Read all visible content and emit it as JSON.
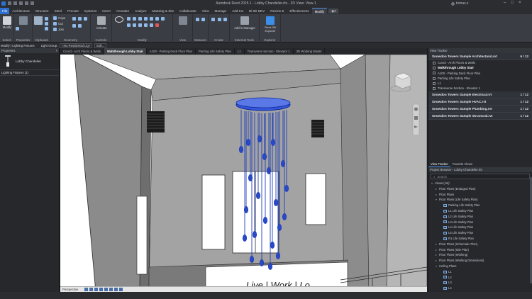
{
  "app": {
    "title": "Autodesk Revit 2025.1 - Lobby Chandelier.rfa - 3D View: View 1",
    "user": "tomas.z"
  },
  "ribbon_tabs": [
    "File",
    "Architecture",
    "Structure",
    "Steel",
    "Precast",
    "Systems",
    "Insert",
    "Annotate",
    "Analyze",
    "Massing & Site",
    "Collaborate",
    "View",
    "Manage",
    "Add-Ins",
    "Bi-IDI DEV",
    "Revizto 5",
    "Effectiveness",
    "Modify"
  ],
  "ribbon_groups": [
    {
      "label": "Select",
      "top": "Modify"
    },
    {
      "label": "Properties",
      "top": ""
    },
    {
      "label": "Clipboard",
      "top": ""
    },
    {
      "label": "Geometry",
      "top": ""
    },
    {
      "label": "Controls",
      "top": "Activate"
    },
    {
      "label": "Modify",
      "top": ""
    },
    {
      "label": "View",
      "top": ""
    },
    {
      "label": "Measure",
      "top": ""
    },
    {
      "label": "Create",
      "top": ""
    },
    {
      "label": "External Tools",
      "top": "Add-in Manager"
    },
    {
      "label": "Explorer",
      "top": "Revit DB Explorer"
    }
  ],
  "ribbon_small": {
    "cope": "Cope",
    "cut": "Cut",
    "join": "Join"
  },
  "context_bar": {
    "mode": "Modify | Lighting Fixtures",
    "light_group": "Light Group:",
    "light_value": "<No Residential Lig>",
    "edit": "Edit..."
  },
  "properties": {
    "title": "Properties",
    "family_name": "Lobby Chandelier",
    "filter": "Lighting Fixtures (1)"
  },
  "view_tabs": [
    {
      "label": "Coord - Arch Floors & Walls",
      "active": false
    },
    {
      "label": "Walkthrough Lobby Stair",
      "active": true
    },
    {
      "label": "A100 - Parking Deck Floor Plan",
      "active": false
    },
    {
      "label": "Parking Life Safety Plan",
      "active": false
    },
    {
      "label": "L1",
      "active": false
    },
    {
      "label": "Transverse Section - Elevator 1",
      "active": false
    },
    {
      "label": "3D Working Model",
      "active": false
    }
  ],
  "viewport": {
    "sign_text": "Live | Work | Lo",
    "view_mode": "Perspective"
  },
  "view_tracker": {
    "title": "View Tracker",
    "models": [
      {
        "name": "Snowdon Towers Sample Architectural.rvt",
        "count": "6 / 12",
        "expanded": true,
        "views": [
          "Coord - Arch Floors & Walls",
          "Walkthrough Lobby Stair",
          "A100 - Parking Deck Floor Plan",
          "Parking Life Safety Plan",
          "L1",
          "Transverse Section - Elevator 1"
        ]
      },
      {
        "name": "Snowdon Towers Sample Electrical.rvt",
        "count": "1 / 12",
        "expanded": false,
        "views": []
      },
      {
        "name": "Snowdon Towers Sample HVAC.rvt",
        "count": "1 / 12",
        "expanded": false,
        "views": []
      },
      {
        "name": "Snowdon Towers Sample Plumbing.rvt",
        "count": "1 / 12",
        "expanded": false,
        "views": []
      },
      {
        "name": "Snowdon Towers Sample Structural.rvt",
        "count": "1 / 12",
        "expanded": false,
        "views": []
      }
    ]
  },
  "browser": {
    "tabs": [
      "View Tracker",
      "Favorite Views"
    ],
    "header": "Project Browser - Lobby Chandelier.rfa",
    "search_placeholder": "Search",
    "tree": [
      {
        "label": "Views (1st)",
        "level": 0,
        "twisty": "-"
      },
      {
        "label": "Floor Plans (Enlarged Plan)",
        "level": 1,
        "twisty": "+"
      },
      {
        "label": "Floor Plans",
        "level": 1,
        "twisty": "+"
      },
      {
        "label": "Floor Plans (Life Safety Plan)",
        "level": 1,
        "twisty": "-"
      },
      {
        "label": "Parking Life Safety Plan",
        "level": 2,
        "twisty": ""
      },
      {
        "label": "L1 Life Safety Plan",
        "level": 2,
        "twisty": ""
      },
      {
        "label": "L2 Life Safety Plan",
        "level": 2,
        "twisty": ""
      },
      {
        "label": "L3 Life Safety Plan",
        "level": 2,
        "twisty": ""
      },
      {
        "label": "L4 Life Safety Plan",
        "level": 2,
        "twisty": ""
      },
      {
        "label": "L5 Life Safety Plan",
        "level": 2,
        "twisty": ""
      },
      {
        "label": "R1 Life Safety Plan",
        "level": 2,
        "twisty": ""
      },
      {
        "label": "Floor Plans (Schematic Plan)",
        "level": 1,
        "twisty": "+"
      },
      {
        "label": "Floor Plans (Site Plan)",
        "level": 1,
        "twisty": "+"
      },
      {
        "label": "Floor Plans (Working)",
        "level": 1,
        "twisty": "+"
      },
      {
        "label": "Floor Plans (Working Dimensions)",
        "level": 1,
        "twisty": "+"
      },
      {
        "label": "Ceiling Plans",
        "level": 1,
        "twisty": "-"
      },
      {
        "label": "L1",
        "level": 2,
        "twisty": ""
      },
      {
        "label": "L2",
        "level": 2,
        "twisty": ""
      },
      {
        "label": "L3",
        "level": 2,
        "twisty": ""
      },
      {
        "label": "L4",
        "level": 2,
        "twisty": ""
      }
    ]
  },
  "colors": {
    "accent": "#2f6fd0",
    "chandelier": "#1f48d8",
    "panel": "#26282c"
  }
}
